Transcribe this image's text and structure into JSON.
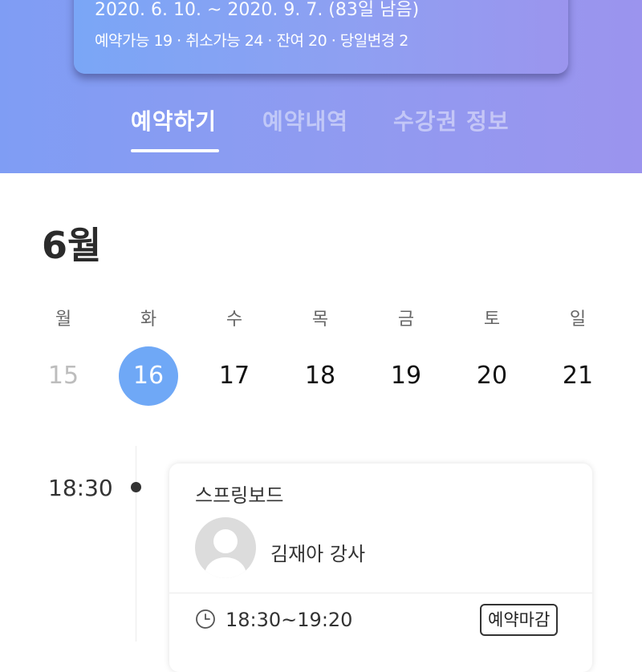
{
  "pass": {
    "period": "2020. 6. 10. ~ 2020. 9. 7.  (83일 남음)",
    "counts": "예약가능 19 · 취소가능 24 · 잔여 20 · 당일변경 2"
  },
  "tabs": [
    {
      "label": "예약하기",
      "active": true
    },
    {
      "label": "예약내역",
      "active": false
    },
    {
      "label": "수강권 정보",
      "active": false
    }
  ],
  "calendar": {
    "month": "6월",
    "weekdays": [
      "월",
      "화",
      "수",
      "목",
      "금",
      "토",
      "일"
    ],
    "dates": [
      {
        "label": "15",
        "state": "past"
      },
      {
        "label": "16",
        "state": "selected"
      },
      {
        "label": "17",
        "state": "normal"
      },
      {
        "label": "18",
        "state": "normal"
      },
      {
        "label": "19",
        "state": "normal"
      },
      {
        "label": "20",
        "state": "normal"
      },
      {
        "label": "21",
        "state": "normal"
      }
    ]
  },
  "schedule": [
    {
      "time": "18:30",
      "class_name": "스프링보드",
      "instructor": "김재아 강사",
      "time_range": "18:30~19:20",
      "status": "예약마감"
    }
  ],
  "colors": {
    "accent": "#6fa8f6",
    "header_gradient_start": "#7f9df4",
    "header_gradient_end": "#9b94ee"
  }
}
